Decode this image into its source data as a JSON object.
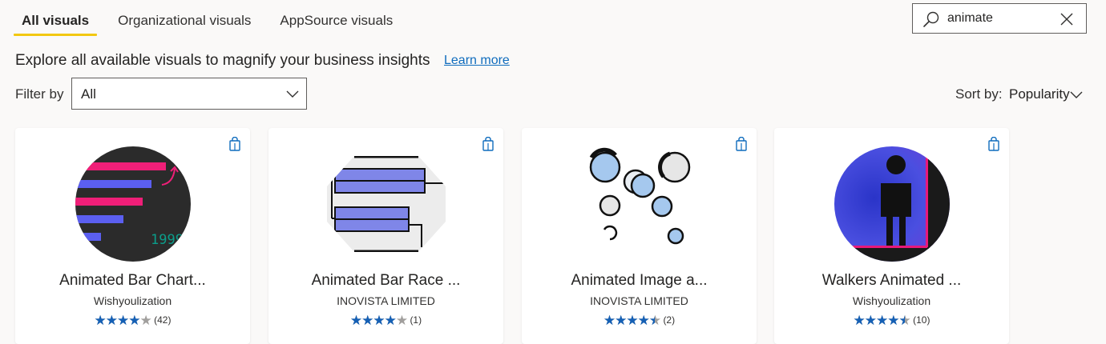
{
  "tabs": [
    {
      "label": "All visuals",
      "active": true
    },
    {
      "label": "Organizational visuals",
      "active": false
    },
    {
      "label": "AppSource visuals",
      "active": false
    }
  ],
  "search": {
    "value": "animate",
    "icon": "search-icon",
    "clear_icon": "close-icon"
  },
  "intro": {
    "text": "Explore all available visuals to magnify your business insights",
    "link": "Learn more"
  },
  "filter": {
    "label": "Filter by",
    "value": "All"
  },
  "sort": {
    "label": "Sort by:",
    "value": "Popularity"
  },
  "colors": {
    "accent": "#f2c811",
    "link": "#0f6cbd",
    "star": "#1560b5"
  },
  "cards": [
    {
      "title": "Animated Bar Chart...",
      "publisher": "Wishyoulization",
      "rating": 4,
      "count": "(42)",
      "art_year": "1999"
    },
    {
      "title": "Animated Bar Race ...",
      "publisher": "INOVISTA LIMITED",
      "rating": 4,
      "count": "(1)"
    },
    {
      "title": "Animated Image a...",
      "publisher": "INOVISTA LIMITED",
      "rating": 4.5,
      "count": "(2)"
    },
    {
      "title": "Walkers Animated ...",
      "publisher": "Wishyoulization",
      "rating": 4.5,
      "count": "(10)"
    }
  ]
}
